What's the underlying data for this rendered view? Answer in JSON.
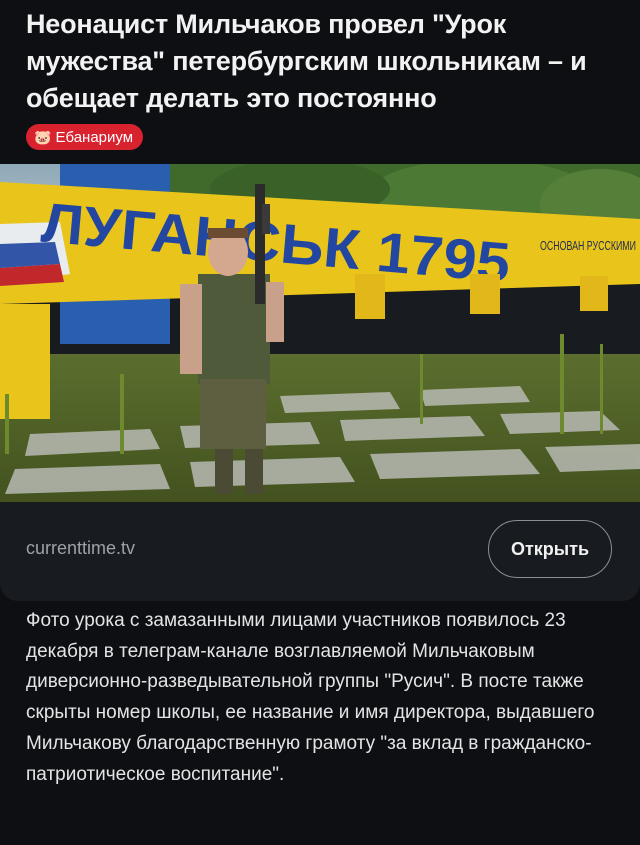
{
  "post": {
    "title": "Неонацист Мильчаков провел \"Урок мужества\" петербургским школьникам – и обещает делать это постоянно",
    "tag_icon": "pig-face-icon",
    "tag_label": "Ебанариум"
  },
  "link_card": {
    "photo_sign_text": "ЛУГАНСЬК 1795",
    "photo_sign_caption": "ОСНОВАН РУССКИМИ",
    "domain": "currenttime.tv",
    "open_label": "Открыть"
  },
  "body": {
    "text": "Фото урока с замазанными лицами участников появилось 23 декабря в телеграм-канале возглавляемой Мильчаковым диверсионно-разведывательной группы \"Русич\". В посте также скрыты номер школы, ее название и имя директора, выдавшего Мильчакову благодарственную грамоту \"за вклад в гражданско-патриотическое воспитание\"."
  },
  "colors": {
    "background": "#0d0f12",
    "card": "#181b20",
    "badge": "#d8232f",
    "sign_yellow": "#e9c51b",
    "sign_blue": "#2a5fb0"
  }
}
